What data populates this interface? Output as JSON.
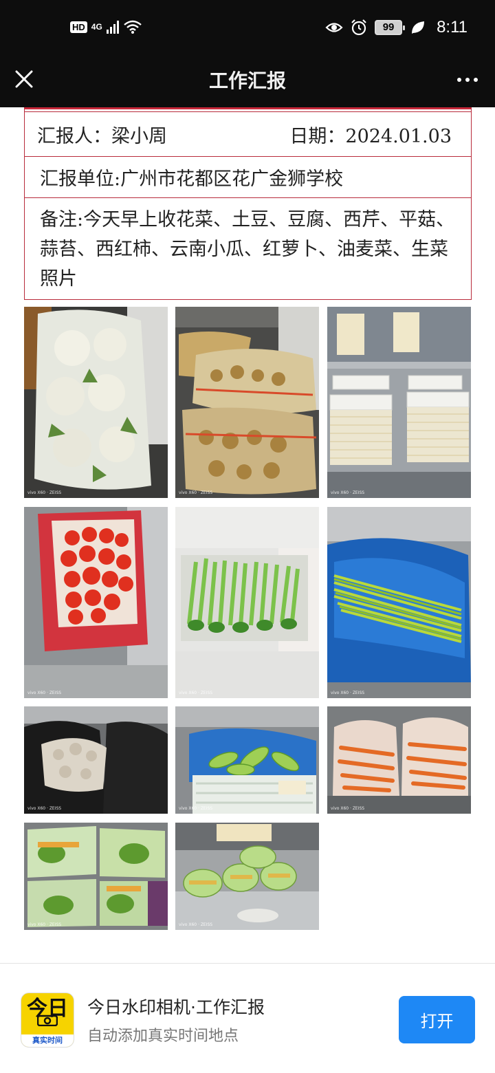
{
  "status_bar": {
    "hd": "HD",
    "network": "4G",
    "battery": "99",
    "time": "8:11"
  },
  "header": {
    "title": "工作汇报",
    "icons": [
      "close-icon",
      "more-icon"
    ]
  },
  "report": {
    "reporter": "汇报人：梁小周",
    "date": "日期：2024.01.03",
    "unit": "汇报单位:广州市花都区花广金狮学校",
    "remark": "备注:今天早上收花菜、土豆、豆腐、西芹、平菇、蒜苔、西红柿、云南小瓜、红萝卜、油麦菜、生菜照片"
  },
  "photos": [
    {
      "subject": "花菜",
      "watermark": "vivo X60 · ZEISS"
    },
    {
      "subject": "土豆",
      "watermark": "vivo X60 · ZEISS"
    },
    {
      "subject": "豆腐",
      "watermark": "vivo X60 · ZEISS"
    },
    {
      "subject": "西红柿",
      "watermark": "vivo X60 · ZEISS"
    },
    {
      "subject": "西芹",
      "watermark": "vivo X60 · ZEISS"
    },
    {
      "subject": "蒜苔",
      "watermark": "vivo X60 · ZEISS"
    },
    {
      "subject": "平菇",
      "watermark": "vivo X60 · ZEISS"
    },
    {
      "subject": "云南小瓜",
      "watermark": "vivo X60 · ZEISS"
    },
    {
      "subject": "红萝卜",
      "watermark": "vivo X60 · ZEISS"
    },
    {
      "subject": "油麦菜",
      "watermark": "vivo X60 · ZEISS"
    },
    {
      "subject": "生菜",
      "watermark": "vivo X60 · ZEISS"
    }
  ],
  "banner": {
    "app_icon_text": "今日",
    "app_icon_strip": "真实时间",
    "app_name": "今日水印相机·工作汇报",
    "app_desc": "自动添加真实时间地点",
    "open_label": "打开",
    "button_color": "#1e88f5"
  }
}
